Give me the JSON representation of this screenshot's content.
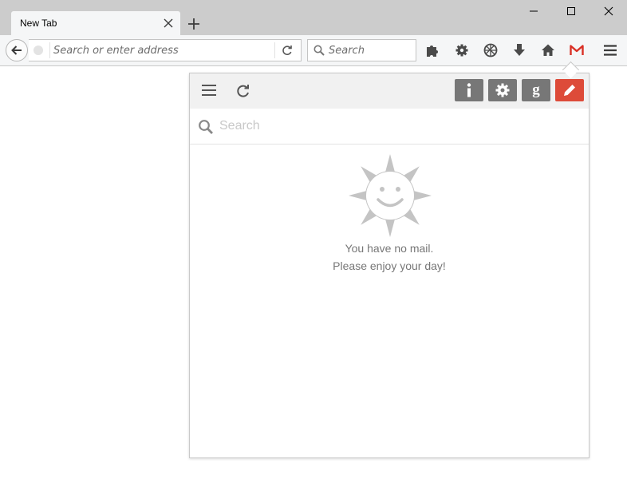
{
  "browser": {
    "tab": {
      "title": "New Tab"
    },
    "urlbar": {
      "placeholder": "Search or enter address"
    },
    "searchbar": {
      "placeholder": "Search"
    },
    "toolbar_icons": [
      "puzzle-icon",
      "gear-icon",
      "globe-grid-icon",
      "download-icon",
      "home-icon",
      "gmail-icon",
      "hamburger-menu-icon"
    ]
  },
  "popup": {
    "header_buttons": [
      "menu-icon",
      "refresh-icon",
      "info-icon",
      "settings-icon",
      "google-icon",
      "compose-icon"
    ],
    "search": {
      "placeholder": "Search"
    },
    "empty_state": {
      "icon": "smiley-sun-icon",
      "line1": "You have no mail.",
      "line2": "Please enjoy your day!"
    },
    "colors": {
      "accent_red": "#dd4b39",
      "button_gray": "#777777"
    }
  }
}
